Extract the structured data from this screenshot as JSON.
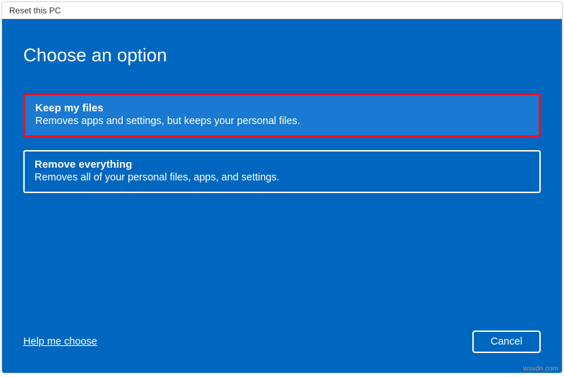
{
  "window": {
    "title": "Reset this PC"
  },
  "heading": "Choose an option",
  "options": {
    "keep": {
      "title": "Keep my files",
      "desc": "Removes apps and settings, but keeps your personal files."
    },
    "remove": {
      "title": "Remove everything",
      "desc": "Removes all of your personal files, apps, and settings."
    }
  },
  "footer": {
    "help_link": "Help me choose",
    "cancel_label": "Cancel"
  },
  "watermark": "wsxdn.com"
}
